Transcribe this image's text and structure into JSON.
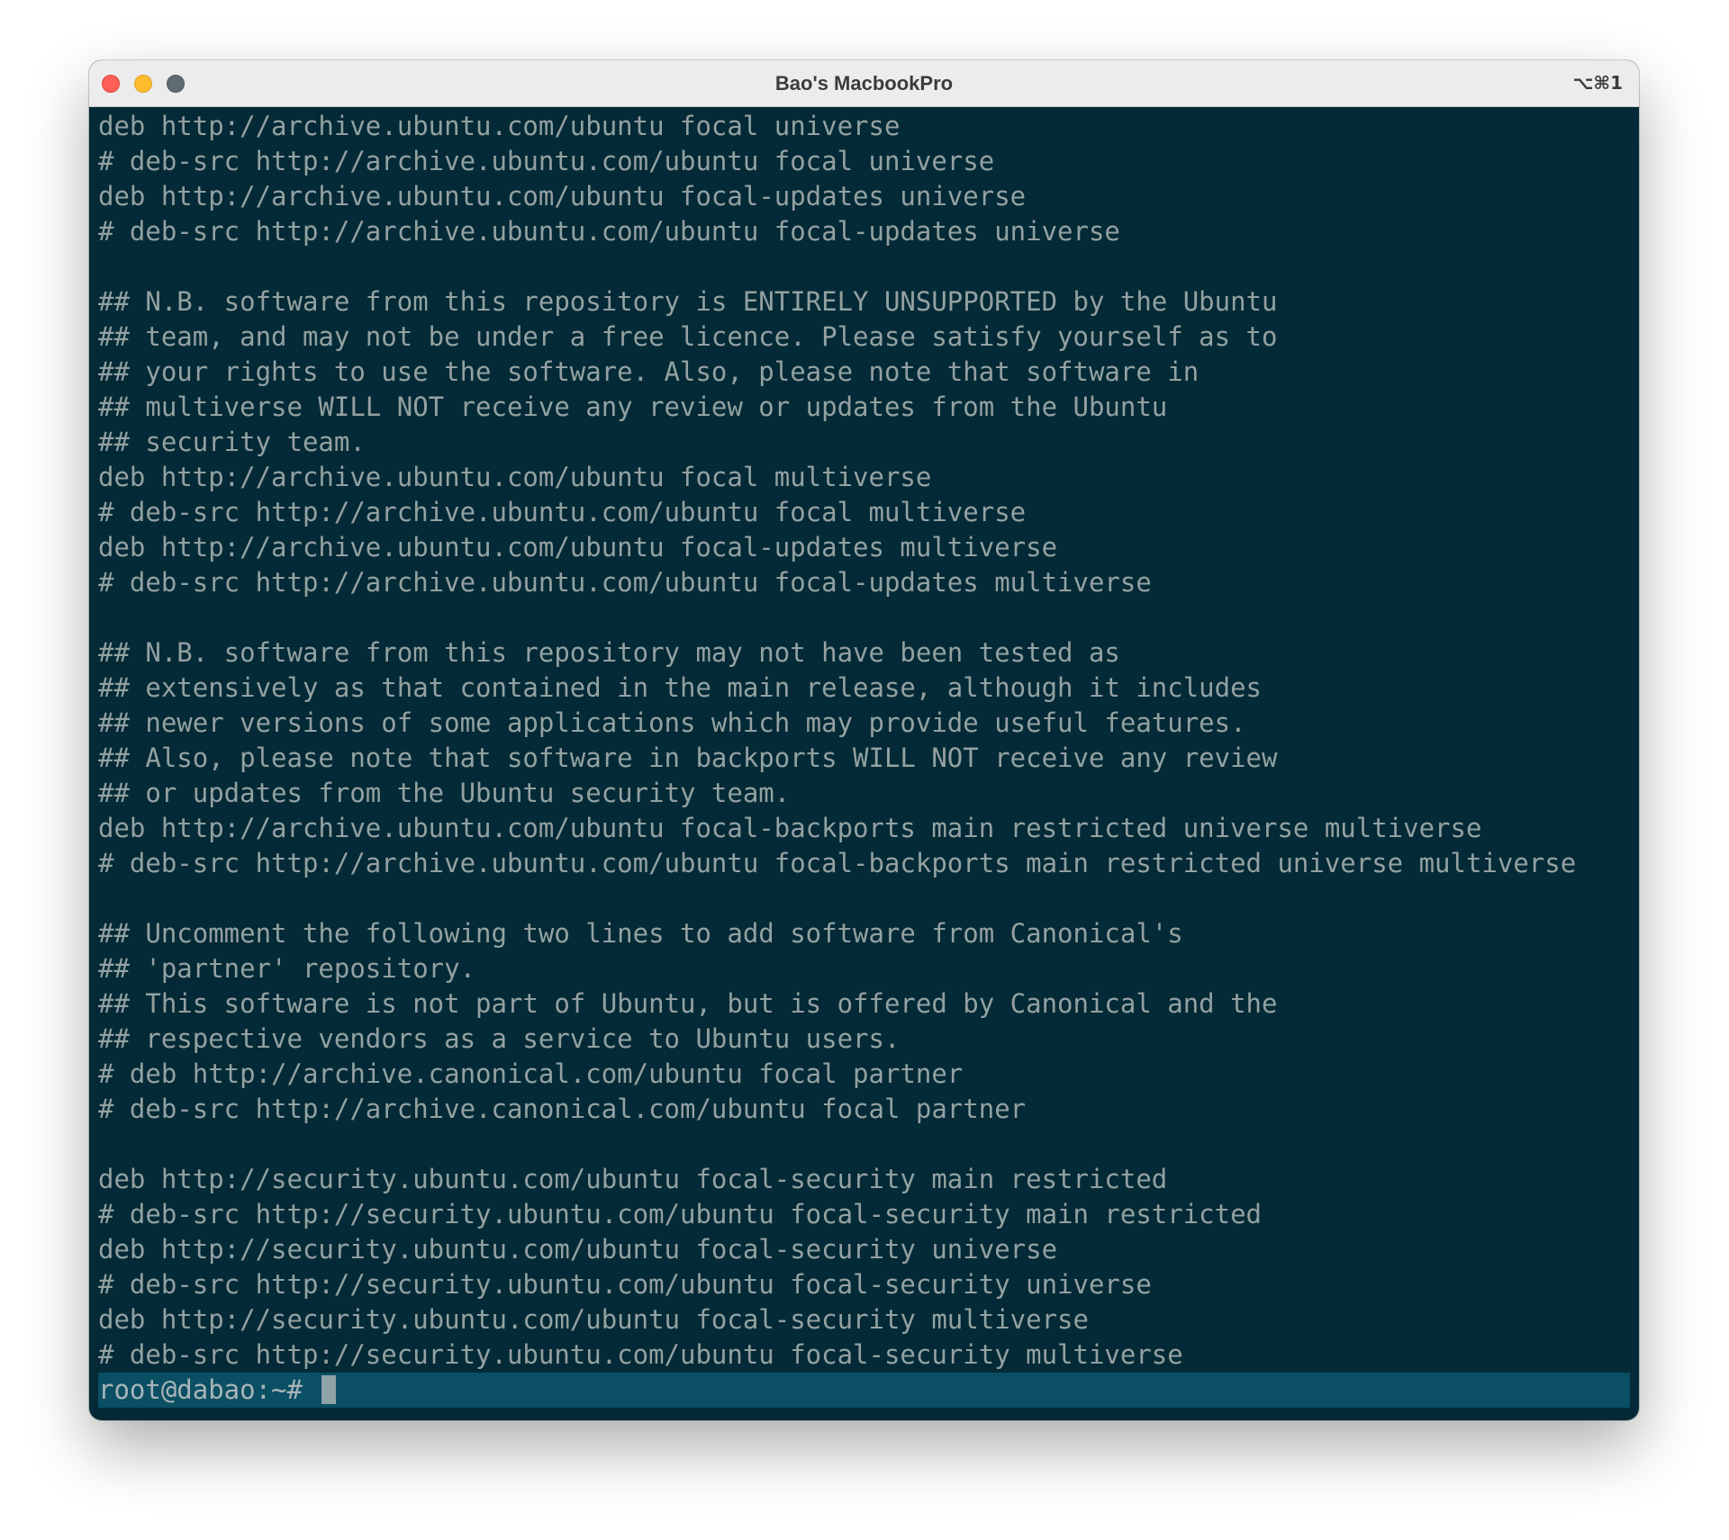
{
  "window": {
    "title": "Bao's MacbookPro",
    "shortcut": "⌥⌘1",
    "traffic_lights": {
      "close": "#fe5f57",
      "minimize": "#febc2e",
      "zoom": "#5f6b72"
    }
  },
  "colors": {
    "background": "#032a36",
    "text": "#93a1a1",
    "prompt_bar": "#0b4f64"
  },
  "terminal": {
    "lines": [
      "deb http://archive.ubuntu.com/ubuntu focal universe",
      "# deb-src http://archive.ubuntu.com/ubuntu focal universe",
      "deb http://archive.ubuntu.com/ubuntu focal-updates universe",
      "# deb-src http://archive.ubuntu.com/ubuntu focal-updates universe",
      "",
      "## N.B. software from this repository is ENTIRELY UNSUPPORTED by the Ubuntu",
      "## team, and may not be under a free licence. Please satisfy yourself as to",
      "## your rights to use the software. Also, please note that software in",
      "## multiverse WILL NOT receive any review or updates from the Ubuntu",
      "## security team.",
      "deb http://archive.ubuntu.com/ubuntu focal multiverse",
      "# deb-src http://archive.ubuntu.com/ubuntu focal multiverse",
      "deb http://archive.ubuntu.com/ubuntu focal-updates multiverse",
      "# deb-src http://archive.ubuntu.com/ubuntu focal-updates multiverse",
      "",
      "## N.B. software from this repository may not have been tested as",
      "## extensively as that contained in the main release, although it includes",
      "## newer versions of some applications which may provide useful features.",
      "## Also, please note that software in backports WILL NOT receive any review",
      "## or updates from the Ubuntu security team.",
      "deb http://archive.ubuntu.com/ubuntu focal-backports main restricted universe multiverse",
      "# deb-src http://archive.ubuntu.com/ubuntu focal-backports main restricted universe multiverse",
      "",
      "## Uncomment the following two lines to add software from Canonical's",
      "## 'partner' repository.",
      "## This software is not part of Ubuntu, but is offered by Canonical and the",
      "## respective vendors as a service to Ubuntu users.",
      "# deb http://archive.canonical.com/ubuntu focal partner",
      "# deb-src http://archive.canonical.com/ubuntu focal partner",
      "",
      "deb http://security.ubuntu.com/ubuntu focal-security main restricted",
      "# deb-src http://security.ubuntu.com/ubuntu focal-security main restricted",
      "deb http://security.ubuntu.com/ubuntu focal-security universe",
      "# deb-src http://security.ubuntu.com/ubuntu focal-security universe",
      "deb http://security.ubuntu.com/ubuntu focal-security multiverse",
      "# deb-src http://security.ubuntu.com/ubuntu focal-security multiverse"
    ],
    "prompt": "root@dabao:~#"
  }
}
